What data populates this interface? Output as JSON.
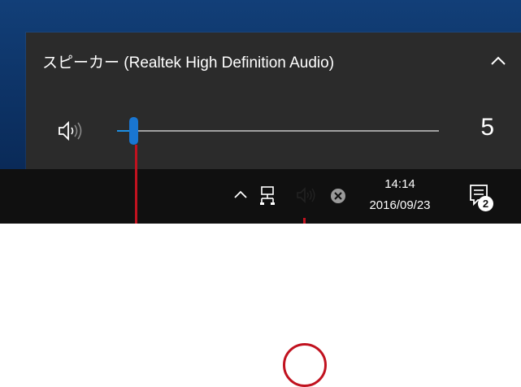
{
  "flyout": {
    "device_name": "スピーカー (Realtek High Definition Audio)",
    "collapse_icon": "chevron-up-icon",
    "speaker_icon": "speaker-icon",
    "volume_value": "5",
    "volume_fraction": 0.05
  },
  "taskbar": {
    "show_hidden_icons": "chevron-up-icon",
    "network_icon": "wired-network-icon",
    "volume_icon": "speaker-icon",
    "status_icon": "close-circle-icon",
    "clock": {
      "time": "14:14",
      "date": "2016/09/23"
    },
    "action_center": {
      "icon": "action-center-icon",
      "badge": "2"
    }
  },
  "colors": {
    "flyout_bg": "#2b2b2b",
    "taskbar_bg": "#101010",
    "accent": "#1976d2",
    "callout": "#c1121f"
  }
}
